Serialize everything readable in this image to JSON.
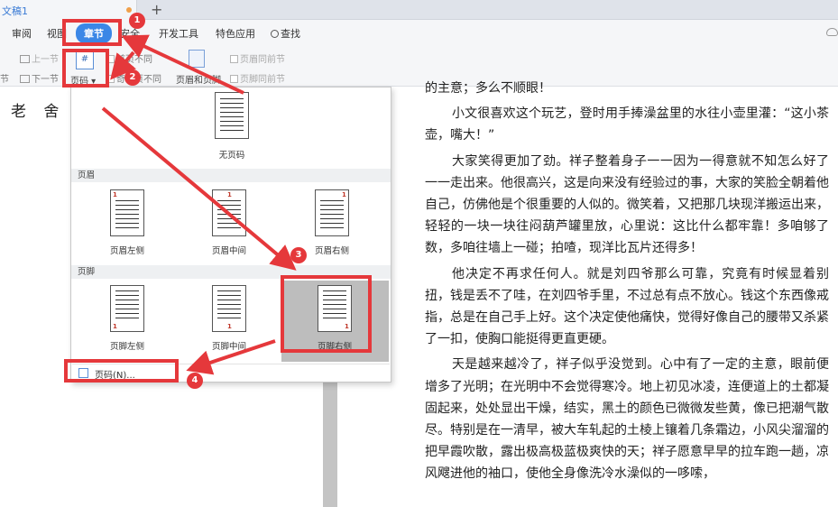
{
  "tab": {
    "name": "文稿1"
  },
  "menu": {
    "items": [
      "审阅",
      "视图",
      "章节",
      "安全",
      "开发工具",
      "特色应用",
      "查找"
    ]
  },
  "ribbon": {
    "prev_section": "上一节",
    "next_section": "下一节",
    "section_left": "节",
    "page_number": "页码",
    "first_page_different": "首页不同",
    "odd_even_different": "奇偶页不同",
    "header_footer": "页眉和页脚",
    "header_same_as_prev": "页眉同前节",
    "footer_same_as_prev": "页脚同前节"
  },
  "dropdown": {
    "no_page_number": "无页码",
    "header_section": "页眉",
    "header_options": [
      "页眉左侧",
      "页眉中间",
      "页眉右侧"
    ],
    "footer_section": "页脚",
    "footer_options": [
      "页脚左侧",
      "页脚中间",
      "页脚右侧"
    ],
    "more_item": "页码(N)...",
    "thumb_number": "1"
  },
  "document": {
    "left_title": "老 舍",
    "paragraphs": [
      "的主意；多么不顺眼！",
      "小文很喜欢这个玩艺，登时用手捧澡盆里的水往小壶里灌：“这小茶壶，嘴大！”",
      "大家笑得更加了劲。祥子整着身子一一因为一得意就不知怎么好了一一走出来。他很高兴，这是向来没有经验过的事，大家的笑脸全朝着他自己，仿佛他是个很重要的人似的。微笑着，又把那几块现洋搬运出来，轻轻的一块一块往闷葫芦罐里放，心里说：这比什么都牢靠！多咱够了数，多咱往墙上一碰；拍喳，现洋比瓦片还得多！",
      "他决定不再求任何人。就是刘四爷那么可靠，究竟有时候显着别扭，钱是丢不了哇，在刘四爷手里，不过总有点不放心。钱这个东西像戒指，总是在自己手上好。这个决定使他痛快，觉得好像自己的腰带又杀紧了一扣，使胸口能挺得更直更硬。",
      "天是越来越冷了，祥子似乎没觉到。心中有了一定的主意，眼前便增多了光明；在光明中不会觉得寒冷。地上初见冰凌，连便道上的土都凝固起来，处处显出干燥，结实，黑土的颜色已微微发些黄，像已把潮气散尽。特别是在一清早，被大车轧起的土棱上镶着几条霜边，小风尖溜溜的把早霞吹散，露出极高极蓝极爽快的天；祥子愿意早早的拉车跑一趟，凉风飕进他的袖口，使他全身像洗冷水澡似的一哆嗦，"
    ]
  },
  "annotations": {
    "badges": [
      "1",
      "2",
      "3",
      "4"
    ]
  },
  "colors": {
    "accent": "#3b87e6",
    "annotation": "#e5383b",
    "tab_text": "#3a7bd5"
  }
}
